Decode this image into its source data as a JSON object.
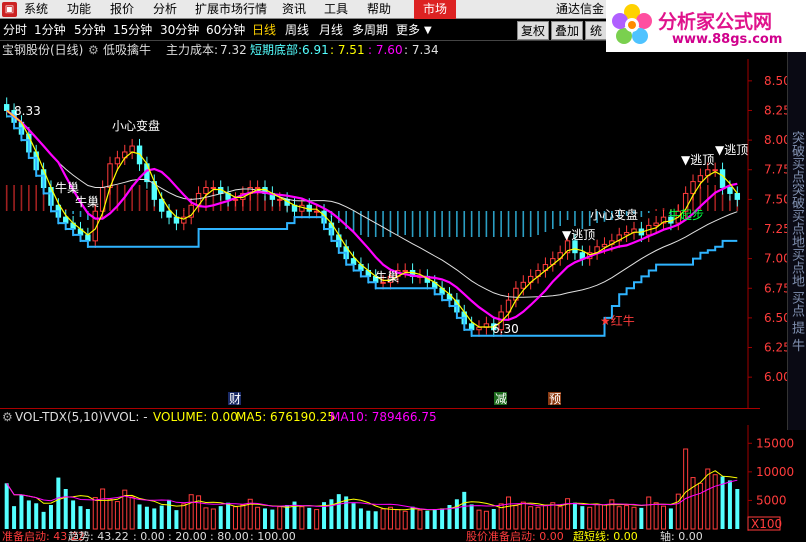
{
  "menu": {
    "items": [
      "系统",
      "功能",
      "报价",
      "分析",
      "扩展市场行情",
      "资讯",
      "工具",
      "帮助"
    ],
    "market_button": "市场",
    "broker": "通达信金"
  },
  "periods": {
    "items": [
      "分时",
      "1分钟",
      "5分钟",
      "15分钟",
      "30分钟",
      "60分钟",
      "日线",
      "周线",
      "月线",
      "多周期",
      "更多"
    ],
    "active": "日线",
    "buttons": [
      "复权",
      "叠加",
      "统"
    ]
  },
  "logo": {
    "brand": "分析家公式网",
    "url": "www.88gs.com"
  },
  "title_line": {
    "stock": "宝钢股份(日线)",
    "indicator": "低吸擒牛",
    "cost_label": "主力成本:",
    "cost_value": "7.32",
    "bottom_label": "短期底部:",
    "bottom_value": "6.91",
    "v1": ": 7.51",
    "v2": ": 7.60",
    "v3": ": 7.34"
  },
  "price_axis": {
    "ticks": [
      "8.50",
      "8.25",
      "8.00",
      "7.75",
      "7.50",
      "7.25",
      "7.00",
      "6.75",
      "6.50",
      "6.25",
      "6.00"
    ],
    "range": [
      5.9,
      8.6
    ]
  },
  "annotations": {
    "high_price": "8.33",
    "low_price": "6.30",
    "caution1": "小心变盘",
    "caution2": "小心变盘",
    "niu_chao1": "牛巢",
    "niu_chao2": "牛巢",
    "niu_chao3": "牛巢",
    "escape1": "▼逃顶",
    "escape2": "▼逃顶",
    "escape3": "▼逃顶",
    "red_bull": "★红牛",
    "bull_start": "牛起步"
  },
  "markers": {
    "cai": "财",
    "jian": "减",
    "yu": "预"
  },
  "volume_header": {
    "indicator": "VOL-TDX(5,10)",
    "vvol": "VVOL: -",
    "volume": "VOLUME: 0.00",
    "ma5": "MA5: 676190.25",
    "ma10": "MA10: 789466.75"
  },
  "volume_axis": {
    "ticks": [
      "15000",
      "10000",
      "5000"
    ],
    "unit": "X100"
  },
  "status_line": {
    "s1": "准备启动: 43.22",
    "s2": "趋势: 43.22",
    "s3": ": 0.00",
    "s4": ": 20.00",
    "s5": ": 80.00",
    "s6": ": 100.00",
    "s7": "股价准备启动: 0.00",
    "s8": "超短线: 0.00",
    "s9": "轴: 0.00"
  },
  "right_strip": "突破买点突破买点地买点地 买点 提 牛",
  "colors": {
    "up": "#ff3c3c",
    "down": "#54ffff",
    "ma_magenta": "#ff00ff",
    "ma_white": "#e0e0e0",
    "ma_yellow": "#ffff00",
    "support_cyan": "#2fb4ff"
  },
  "chart_data": {
    "type": "candlestick",
    "title": "宝钢股份(日线)",
    "ylim": [
      5.9,
      8.6
    ],
    "close": [
      8.25,
      8.15,
      8.05,
      7.9,
      7.75,
      7.6,
      7.45,
      7.35,
      7.3,
      7.25,
      7.2,
      7.15,
      7.4,
      7.6,
      7.8,
      7.85,
      7.9,
      7.95,
      7.8,
      7.65,
      7.5,
      7.4,
      7.35,
      7.3,
      7.35,
      7.45,
      7.55,
      7.6,
      7.6,
      7.55,
      7.5,
      7.5,
      7.55,
      7.6,
      7.6,
      7.55,
      7.5,
      7.5,
      7.45,
      7.4,
      7.45,
      7.4,
      7.4,
      7.3,
      7.2,
      7.1,
      7.0,
      6.95,
      6.9,
      6.85,
      6.8,
      6.8,
      6.85,
      6.9,
      6.9,
      6.85,
      6.85,
      6.8,
      6.75,
      6.7,
      6.65,
      6.55,
      6.45,
      6.4,
      6.42,
      6.45,
      6.4,
      6.55,
      6.65,
      6.75,
      6.8,
      6.85,
      6.9,
      6.95,
      7.0,
      7.05,
      7.15,
      7.05,
      7.0,
      7.05,
      7.1,
      7.12,
      7.15,
      7.2,
      7.22,
      7.25,
      7.2,
      7.28,
      7.3,
      7.35,
      7.3,
      7.4,
      7.55,
      7.65,
      7.7,
      7.75,
      7.75,
      7.6,
      7.55,
      7.5
    ],
    "volume": [
      8000,
      4000,
      6000,
      5000,
      4500,
      3000,
      4200,
      9000,
      7000,
      5000,
      4000,
      3500,
      5500,
      7000,
      5200,
      4800,
      6800,
      5600,
      4300,
      3900,
      3600,
      4100,
      5100,
      3300,
      4400,
      6000,
      5800,
      3700,
      3500,
      4000,
      4600,
      3900,
      4200,
      5200,
      3800,
      3600,
      3400,
      3900,
      4200,
      4800,
      3900,
      3700,
      3400,
      4700,
      5200,
      6100,
      5700,
      4500,
      3600,
      3200,
      3100,
      3500,
      3800,
      3400,
      3100,
      3900,
      3300,
      3200,
      3500,
      3600,
      4200,
      5200,
      6500,
      4300,
      3300,
      3100,
      3500,
      4400,
      5600,
      4100,
      4700,
      3900,
      3800,
      4200,
      4600,
      3900,
      5300,
      4600,
      4000,
      3800,
      4300,
      4200,
      5100,
      3900,
      4100,
      3800,
      3700,
      5600,
      4600,
      4000,
      3600,
      6100,
      14000,
      9000,
      8000,
      10500,
      9500,
      9200,
      8500,
      7000
    ]
  }
}
